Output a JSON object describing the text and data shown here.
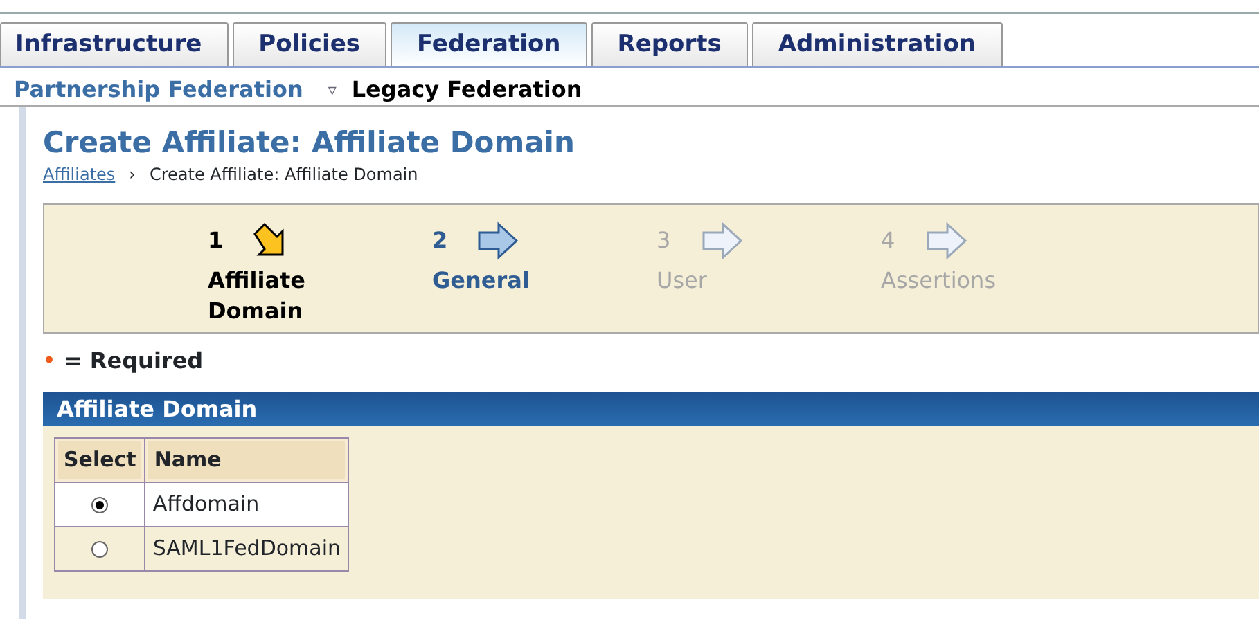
{
  "tabs": [
    {
      "label": "Infrastructure",
      "selected": false
    },
    {
      "label": "Policies",
      "selected": false
    },
    {
      "label": "Federation",
      "selected": true
    },
    {
      "label": "Reports",
      "selected": false
    },
    {
      "label": "Administration",
      "selected": false
    }
  ],
  "subnav": [
    {
      "label": "Partnership Federation",
      "selected": false
    },
    {
      "label": "Legacy Federation",
      "selected": true,
      "menu_glyph": "▿"
    }
  ],
  "page_title": "Create Affiliate: Affiliate Domain",
  "breadcrumb": {
    "link": "Affiliates",
    "separator": "›",
    "current": "Create Affiliate: Affiliate Domain"
  },
  "wizard_steps": [
    {
      "number": "1",
      "label": "Affiliate Domain",
      "current": true
    },
    {
      "number": "2",
      "label": "General",
      "current": false,
      "available": true
    },
    {
      "number": "3",
      "label": "User",
      "current": false,
      "available": false
    },
    {
      "number": "4",
      "label": "Assertions",
      "current": false,
      "available": false
    }
  ],
  "required_note": {
    "marker": "•",
    "text": "= Required"
  },
  "section": {
    "title": "Affiliate Domain",
    "table": {
      "columns": [
        "Select",
        "Name"
      ],
      "rows": [
        {
          "name": "Affdomain",
          "selected": true
        },
        {
          "name": "SAML1FedDomain",
          "selected": false
        }
      ]
    }
  }
}
